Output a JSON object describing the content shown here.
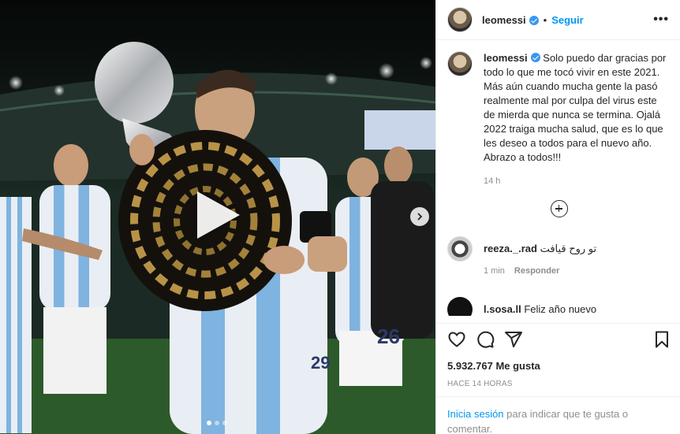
{
  "post": {
    "username": "leomessi",
    "follow_label": "Seguir",
    "separator": "•",
    "more_label": "•••",
    "caption_username": "leomessi",
    "caption_text": "Solo puedo dar gracias por todo lo que me tocó vivir en este 2021. Más aún cuando mucha gente la pasó realmente mal por culpa del virus este de mierda que nunca se termina. Ojalá 2022 traiga mucha salud, que es lo que les deseo a todos para el nuevo año. Abrazo a todos!!!",
    "caption_time": "14 h"
  },
  "comments": [
    {
      "username": "reeza._.rad",
      "text": "تو روح قیافت",
      "time": "1 min",
      "reply_label": "Responder"
    },
    {
      "username": "l.sosa.ll",
      "text": "Feliz año nuevo"
    }
  ],
  "engagement": {
    "likes": "5.932.767 Me gusta",
    "posted": "HACE 14 HORAS"
  },
  "login_prompt": {
    "link": "Inicia sesión",
    "text": " para indicar que te gusta o comentar."
  },
  "icons": {
    "like": "heart-icon",
    "comment": "comment-icon",
    "share": "share-icon",
    "save": "bookmark-icon",
    "play": "play-icon",
    "next": "chevron-right-icon",
    "load_more": "plus-circle-icon"
  },
  "colors": {
    "accent": "#0095f6",
    "verified": "#3897f0",
    "muted": "#8e8e8e"
  }
}
